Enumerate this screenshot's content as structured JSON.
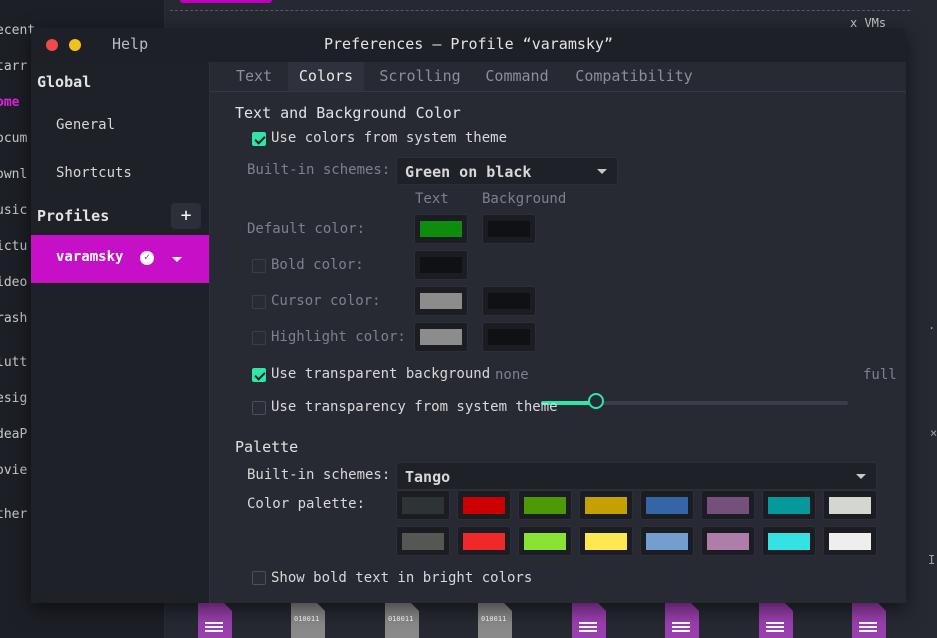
{
  "background": {
    "sidebar_items": [
      "ecent",
      "tarr",
      "ome",
      "ocum",
      "ownl",
      "usic",
      "ictu",
      "ideo",
      "rash",
      "lutt",
      "esig",
      "deaP",
      "ovie",
      "ther"
    ],
    "vms_label": "x VMs",
    "binary_label": "010011"
  },
  "window": {
    "title": "Preferences – Profile “varamsky”",
    "help_menu": "Help"
  },
  "sidebar": {
    "global_heading": "Global",
    "general": "General",
    "shortcuts": "Shortcuts",
    "profiles_heading": "Profiles",
    "add_symbol": "+",
    "profile_name": "varamsky"
  },
  "tabs": [
    "Text",
    "Colors",
    "Scrolling",
    "Command",
    "Compatibility"
  ],
  "active_tab": "Colors",
  "colors": {
    "section_title": "Text and Background Color",
    "use_system_colors": "Use colors from system theme",
    "builtin_schemes_label": "Built-in schemes:",
    "builtin_scheme_value": "Green on black",
    "text_col": "Text",
    "background_col": "Background",
    "default_color": "Default color:",
    "bold_color": "Bold color:",
    "cursor_color": "Cursor color:",
    "highlight_color": "Highlight color:",
    "use_transparent_bg": "Use transparent background",
    "transparency_none": "none",
    "transparency_full": "full",
    "transparency_level": 0.18,
    "use_system_transparency": "Use transparency from system theme",
    "default_text_color": "#0e8c0e",
    "default_bg_color": "#101114",
    "bold_text_color": "#101114",
    "cursor_text_color": "#8c8c8c",
    "cursor_bg_color": "#101114",
    "highlight_text_color": "#8c8c8c",
    "highlight_bg_color": "#101114"
  },
  "palette": {
    "section_title": "Palette",
    "builtin_schemes_label": "Built-in schemes:",
    "builtin_scheme_value": "Tango",
    "color_palette_label": "Color palette:",
    "row1": [
      "#2e3436",
      "#cc0000",
      "#4e9a06",
      "#c4a000",
      "#3465a4",
      "#75507b",
      "#06989a",
      "#d3d7cf"
    ],
    "row2": [
      "#555753",
      "#ef2929",
      "#8ae234",
      "#fce94f",
      "#729fcf",
      "#ad7fa8",
      "#34e2e2",
      "#eeeeec"
    ],
    "bold_bright": "Show bold text in bright colors"
  }
}
